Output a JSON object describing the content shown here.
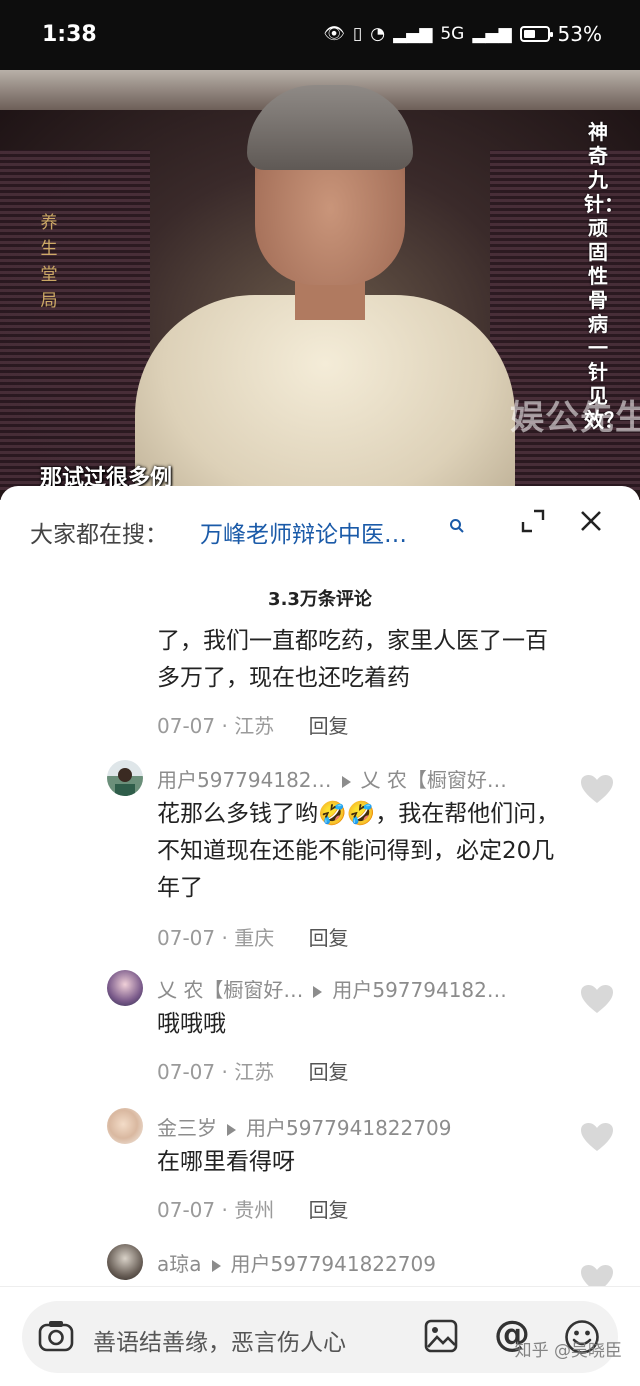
{
  "status": {
    "time": "1:38",
    "network": "5G",
    "battery_text": "53%",
    "battery_level": 0.53
  },
  "video": {
    "side_caption": "神奇九针：顽固性骨病 一针见效？",
    "left_logo": "养生堂局",
    "watermark": "娱公先生",
    "subtitle": "那试过很多例"
  },
  "search": {
    "label": "大家都在搜：",
    "query": "万峰老师辩论中医…"
  },
  "comments_title": "3.3万条评论",
  "comments": [
    {
      "partial": true,
      "text": "了，我们一直都吃药，家里人医了一百多万了，现在也还吃着药",
      "date": "07-07",
      "location": "江苏",
      "reply_label": "回复"
    },
    {
      "user": "用户597794182…",
      "reply_to": "乂 农【橱窗好…",
      "text": "花那么多钱了哟🤣🤣，我在帮他们问，不知道现在还能不能问得到，必定20几年了",
      "date": "07-07",
      "location": "重庆",
      "reply_label": "回复"
    },
    {
      "user": "乂 农【橱窗好…",
      "reply_to": "用户597794182…",
      "text": "哦哦哦",
      "date": "07-07",
      "location": "江苏",
      "reply_label": "回复"
    },
    {
      "user": "金三岁",
      "reply_to": "用户5977941822709",
      "text": "在哪里看得呀",
      "date": "07-07",
      "location": "贵州",
      "reply_label": "回复"
    },
    {
      "user": "a琼a",
      "reply_to": "用户5977941822709"
    }
  ],
  "input": {
    "placeholder": "善语结善缘，恶言伤人心"
  },
  "watermark_bottom": "知乎 @吴晓臣",
  "colors": {
    "link_blue": "#1a5aa8",
    "meta_gray": "#9a9a9a",
    "status_bg": "#0d0d0d"
  }
}
